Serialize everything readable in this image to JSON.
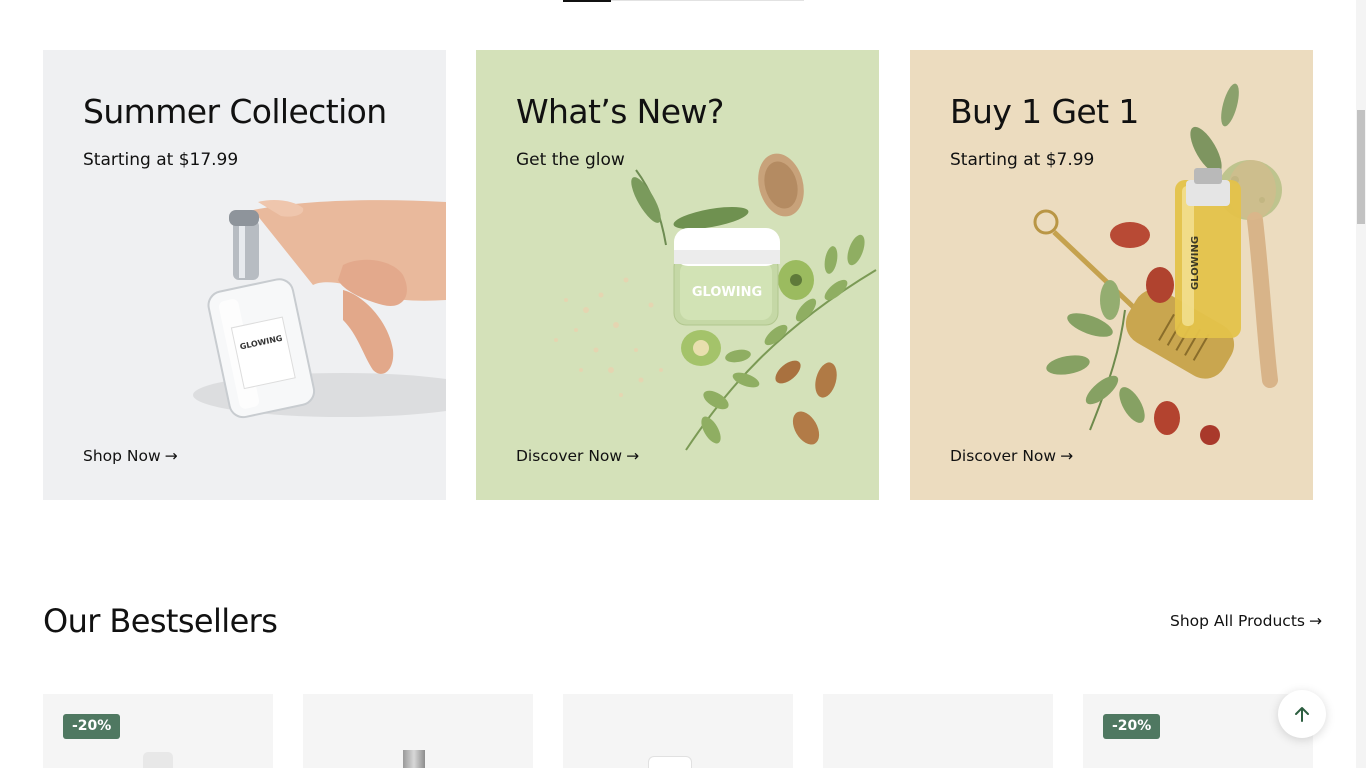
{
  "banners": [
    {
      "title": "Summer Collection",
      "subtitle": "Starting at $17.99",
      "link": "Shop Now",
      "bottle_label": "GLOWING"
    },
    {
      "title": "What’s New?",
      "subtitle": "Get the glow",
      "link": "Discover Now",
      "jar_label": "GLOWING"
    },
    {
      "title": "Buy 1 Get 1",
      "subtitle": "Starting at $7.99",
      "link": "Discover Now",
      "bottle_label": "GLOWING"
    }
  ],
  "link_arrow": "→",
  "bestsellers": {
    "title": "Our Bestsellers",
    "shop_all": "Shop All Products",
    "products": [
      {
        "badge": "-20%"
      },
      {
        "badge": ""
      },
      {
        "badge": ""
      },
      {
        "badge": ""
      },
      {
        "badge": "-20%"
      }
    ]
  },
  "colors": {
    "badge": "#4f7861",
    "banner1_bg": "#eff0f2",
    "banner2_bg": "#d4e1b9",
    "banner3_bg": "#ecdcbf"
  },
  "icons": {
    "link": "arrow-right-icon",
    "to_top": "arrow-up-icon"
  }
}
